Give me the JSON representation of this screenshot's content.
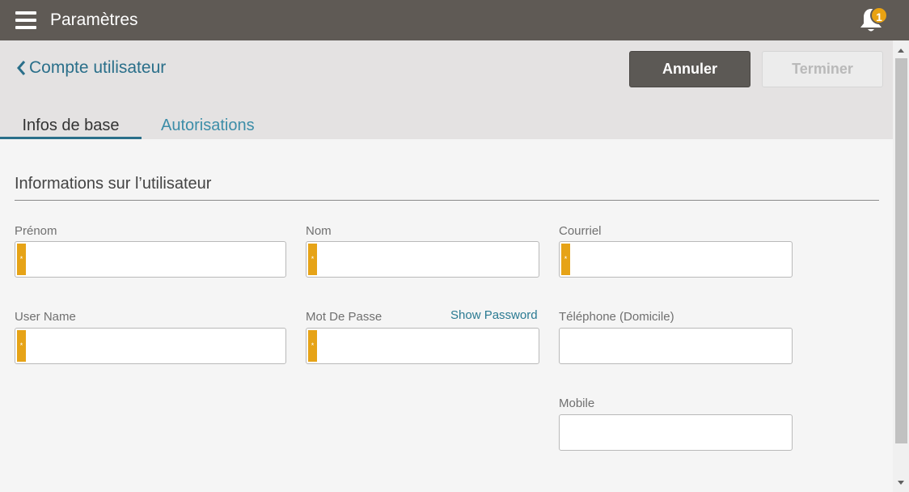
{
  "topbar": {
    "title": "Paramètres",
    "notification_count": "1",
    "icons": [
      "hamburger-menu-icon",
      "bell-icon"
    ]
  },
  "header": {
    "back_label": "Compte utilisateur",
    "cancel_label": "Annuler",
    "finish_label": "Terminer"
  },
  "tabs": [
    {
      "label": "Infos de base",
      "active": true
    },
    {
      "label": "Autorisations",
      "active": false
    }
  ],
  "section": {
    "title": "Informations sur l’utilisateur"
  },
  "fields": {
    "first_name": {
      "label": "Prénom",
      "value": "",
      "required": true
    },
    "last_name": {
      "label": "Nom",
      "value": "",
      "required": true
    },
    "email": {
      "label": "Courriel",
      "value": "",
      "required": true
    },
    "username": {
      "label": "User Name",
      "value": "",
      "required": true
    },
    "password": {
      "label": "Mot De Passe",
      "value": "",
      "required": true,
      "toggle_label": "Show Password"
    },
    "home_phone": {
      "label": "Téléphone (Domicile)",
      "value": "",
      "required": false
    },
    "mobile": {
      "label": "Mobile",
      "value": "",
      "required": false
    }
  },
  "required_marker": "*",
  "colors": {
    "topbar": "#5f5a55",
    "accent": "#2a6f8a",
    "required": "#e6a317",
    "badge": "#e8a212"
  }
}
